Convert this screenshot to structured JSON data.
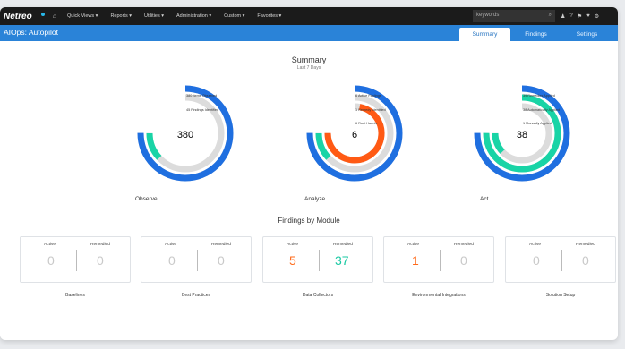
{
  "app": {
    "logo": "Netreo",
    "nav": [
      "Quick Views ▾",
      "Reports ▾",
      "Utilities ▾",
      "Administration ▾",
      "Custom ▾",
      "Favorites ▾"
    ],
    "search_placeholder": "keywords",
    "page_title": "AIOps: Autopilot",
    "tabs": [
      {
        "label": "Summary",
        "active": true
      },
      {
        "label": "Findings",
        "active": false
      },
      {
        "label": "Settings",
        "active": false
      }
    ]
  },
  "summary": {
    "title": "Summary",
    "subtitle": "Last 7 Days"
  },
  "rings": [
    {
      "label": "Observe",
      "center_value": "380",
      "center_color": "#333333",
      "annotations": [
        "380 Items Observed",
        "45 Findings Identified"
      ],
      "tracks": [
        {
          "color": "#1f6fe0",
          "fraction": 0.75
        },
        {
          "color": "#19d4a6",
          "fraction": 0.12
        }
      ]
    },
    {
      "label": "Analyze",
      "center_value": "6",
      "center_color": "#333333",
      "annotations": [
        "6 Active Findings",
        "1 Remedy Identified",
        "6 Root Haunts"
      ],
      "tracks": [
        {
          "color": "#1f6fe0",
          "fraction": 0.75
        },
        {
          "color": "#19d4a6",
          "fraction": 0.12
        },
        {
          "color": "#ff5a14",
          "fraction": 0.72
        }
      ]
    },
    {
      "label": "Act",
      "center_value": "38",
      "center_color": "#333333",
      "annotations": [
        "39 Remedies Applied",
        "38 Automatically Applied",
        "1 Manually Applied"
      ],
      "tracks": [
        {
          "color": "#1f6fe0",
          "fraction": 0.75
        },
        {
          "color": "#19d4a6",
          "fraction": 0.75
        },
        {
          "color": "#19d4a6",
          "fraction": 0.12
        }
      ]
    }
  ],
  "findings": {
    "title": "Findings by Module",
    "active_label": "Active",
    "remedied_label": "Remedied",
    "modules": [
      {
        "name": "Baselines",
        "active": "0",
        "remedied": "0",
        "active_color": "#c9c9c9",
        "remedied_color": "#c9c9c9"
      },
      {
        "name": "Best Practices",
        "active": "0",
        "remedied": "0",
        "active_color": "#c9c9c9",
        "remedied_color": "#c9c9c9"
      },
      {
        "name": "Data Collectors",
        "active": "5",
        "remedied": "37",
        "active_color": "#ff6a1a",
        "remedied_color": "#19c9a3"
      },
      {
        "name": "Environmental Integrations",
        "active": "1",
        "remedied": "0",
        "active_color": "#ff6a1a",
        "remedied_color": "#c9c9c9"
      },
      {
        "name": "Solution Setup",
        "active": "0",
        "remedied": "0",
        "active_color": "#c9c9c9",
        "remedied_color": "#c9c9c9"
      }
    ]
  }
}
